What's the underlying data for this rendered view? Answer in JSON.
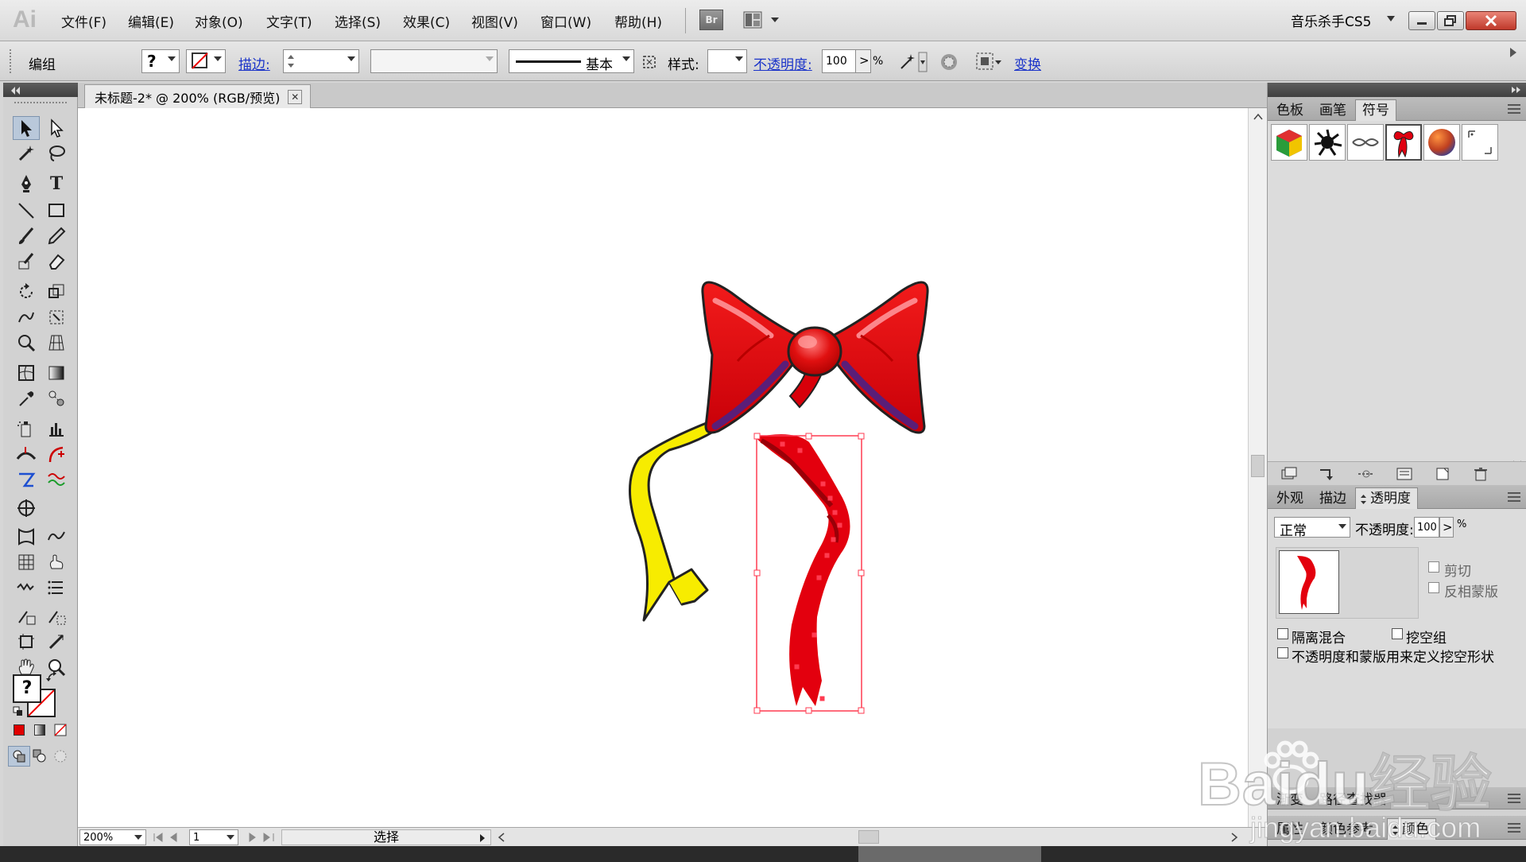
{
  "app": {
    "logo_text": "Ai",
    "workspace_name": "音乐杀手CS5"
  },
  "menu": [
    "文件(F)",
    "编辑(E)",
    "对象(O)",
    "文字(T)",
    "选择(S)",
    "效果(C)",
    "视图(V)",
    "窗口(W)",
    "帮助(H)"
  ],
  "br_button": "Br",
  "control_bar": {
    "selection_type": "编组",
    "fill_symbol": "?",
    "stroke_label": "描边:",
    "brush_value": "基本",
    "style_label": "样式:",
    "opacity_label": "不透明度:",
    "opacity_value": "100",
    "opacity_arrow": ">",
    "percent": "%",
    "transform_label": "变换"
  },
  "document": {
    "tab_title": "未标题-2* @ 200% (RGB/预览)",
    "close_symbol": "✕"
  },
  "status": {
    "zoom": "200%",
    "artboard": "1",
    "mode": "选择"
  },
  "panels": {
    "top_tabs": [
      "色板",
      "画笔",
      "符号"
    ],
    "mid_tabs": [
      "外观",
      "描边",
      "透明度"
    ],
    "blend_mode": "正常",
    "opacity_label": "不透明度:",
    "opacity_value": "100",
    "opacity_arrow": ">",
    "percent": "%",
    "clip_label": "剪切",
    "invert_mask_label": "反相蒙版",
    "isolate_blend_label": "隔离混合",
    "knockout_group_label": "挖空组",
    "opacity_mask_label": "不透明度和蒙版用来定义挖空形状",
    "bottom1_tabs": [
      "渐变",
      "路径查找器"
    ],
    "bottom2_tabs": [
      "属性",
      "颜色参考",
      "颜色"
    ]
  },
  "watermark": {
    "brand": "Baidu经验",
    "url": "jingyan.baidu.com"
  },
  "colors": {
    "ribbon_red": "#e0000e",
    "ribbon_yellow": "#f7ec00",
    "selection": "#ff3b50",
    "link": "#1a33c9"
  }
}
